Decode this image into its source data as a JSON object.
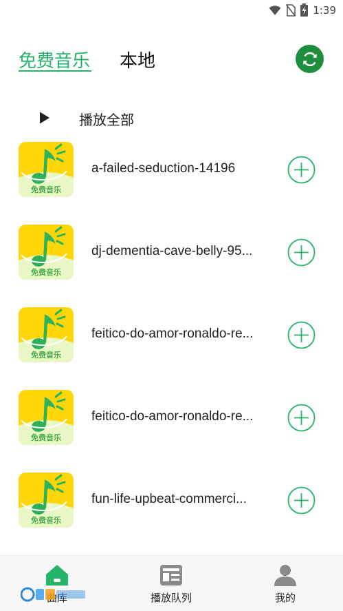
{
  "status_bar": {
    "time": "1:39",
    "icons": [
      "wifi-icon",
      "no-sim-icon",
      "battery-charging-icon"
    ]
  },
  "header": {
    "tabs": [
      {
        "label": "免费音乐",
        "active": true
      },
      {
        "label": "本地",
        "active": false
      }
    ],
    "refresh_icon": "refresh-icon"
  },
  "play_all": {
    "label": "播放全部",
    "icon": "play-icon"
  },
  "songs": [
    {
      "title": "a-failed-seduction-14196",
      "cover_label": "免费音乐"
    },
    {
      "title": "dj-dementia-cave-belly-95...",
      "cover_label": "免费音乐"
    },
    {
      "title": "feitico-do-amor-ronaldo-re...",
      "cover_label": "免费音乐"
    },
    {
      "title": "feitico-do-amor-ronaldo-re...",
      "cover_label": "免费音乐"
    },
    {
      "title": "fun-life-upbeat-commerci...",
      "cover_label": "免费音乐"
    }
  ],
  "bottom_nav": {
    "items": [
      {
        "label": "曲库",
        "icon": "home-icon",
        "active": true
      },
      {
        "label": "播放队列",
        "icon": "queue-icon",
        "active": false
      },
      {
        "label": "我的",
        "icon": "profile-icon",
        "active": false
      }
    ]
  },
  "colors": {
    "accent": "#26b36a",
    "refresh_bg": "#1e8e3e",
    "cover_bg": "#ffd60a",
    "nav_bg": "#f7f7f7"
  }
}
